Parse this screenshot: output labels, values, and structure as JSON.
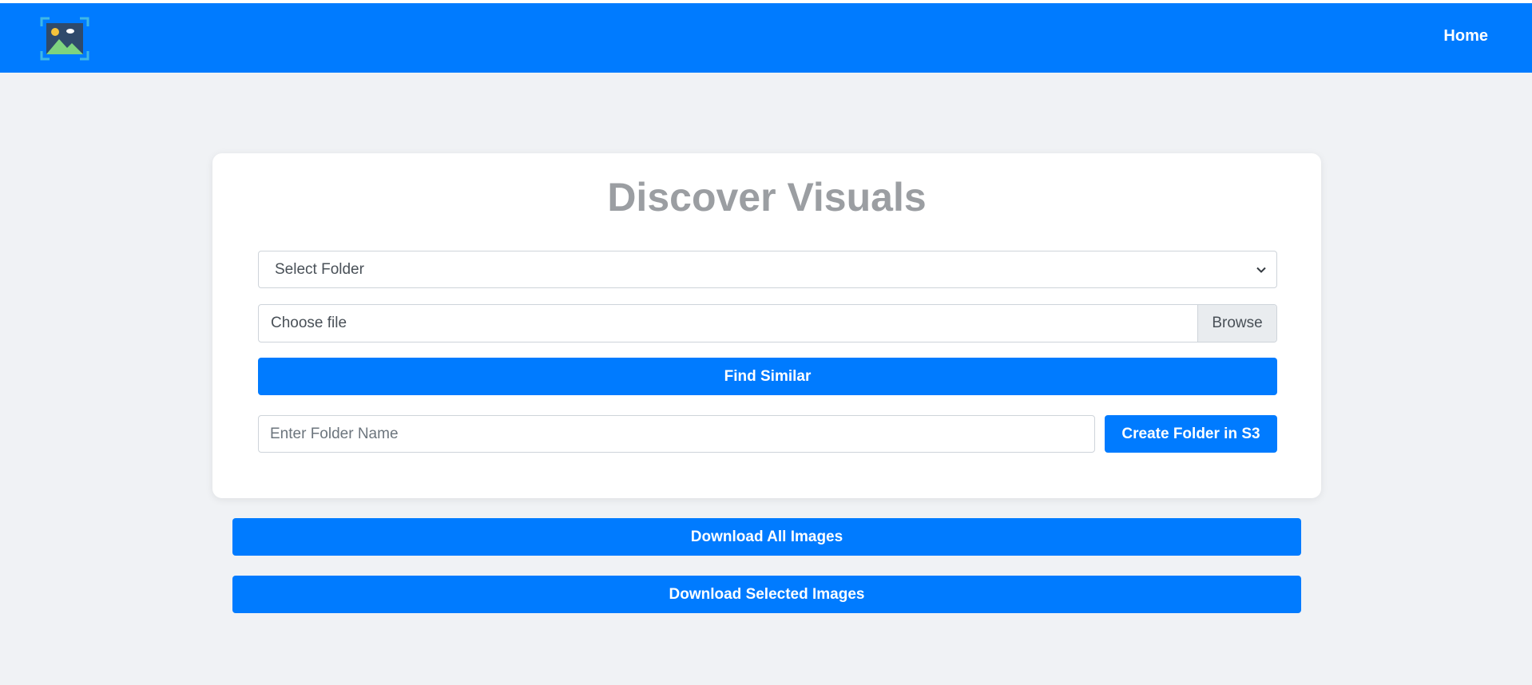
{
  "header": {
    "logo_icon": "image-gallery-logo-icon",
    "nav_home_label": "Home",
    "brand_color": "#007bff"
  },
  "main": {
    "title": "Discover Visuals",
    "folder_select": {
      "selected_value": "Select Folder"
    },
    "file_input": {
      "value": "Choose file",
      "browse_label": "Browse"
    },
    "find_similar_label": "Find Similar",
    "folder_name_input": {
      "value": "",
      "placeholder": "Enter Folder Name"
    },
    "create_folder_label": "Create Folder in S3"
  },
  "actions": {
    "download_all_label": "Download All Images",
    "download_selected_label": "Download Selected Images"
  }
}
